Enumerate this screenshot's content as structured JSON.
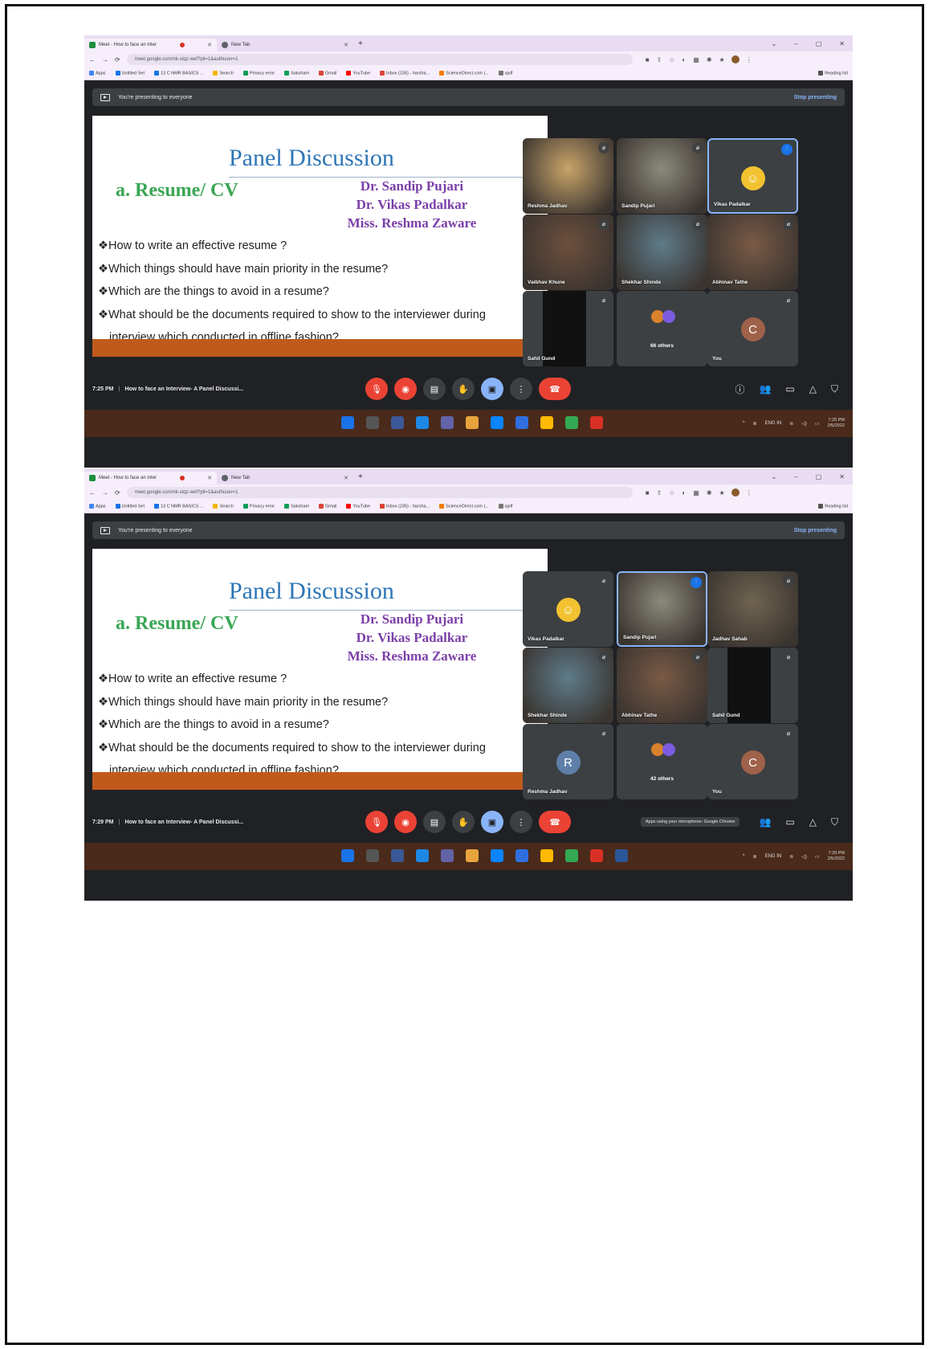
{
  "screens": [
    {
      "tabs": {
        "active": "Meet - How to face an inter",
        "inactive": "New Tab"
      },
      "url": "meet.google.com/nk-stqz-wef?pli=1&authuser=1",
      "bookmarks": [
        "Apps",
        "Untitled Set",
        "13 C NMR BASICS ...",
        "Search",
        "Privacy error",
        "Saksham",
        "Gmail",
        "YouTube",
        "Inbox (235) - harsha...",
        "ScienceDirect.com |...",
        "ajxlf"
      ],
      "reading_list": "Reading list",
      "presenting": {
        "text": "You're presenting to everyone",
        "stop": "Stop presenting"
      },
      "slide": {
        "title": "Panel Discussion",
        "subtitle": "a. Resume/ CV",
        "names": [
          "Dr. Sandip Pujari",
          "Dr. Vikas Padalkar",
          "Miss. Reshma Zaware"
        ],
        "bullets": [
          "❖How to write an effective resume ?",
          "❖Which things should have main priority in the resume?",
          "❖Which are the things to avoid in a resume?",
          "❖What should be the documents required to show to the interviewer during"
        ],
        "continuation": "interview which conducted in offline fashion?"
      },
      "tiles": [
        {
          "name": "Reshma Jadhav",
          "kind": "video",
          "color": "#c9a46a"
        },
        {
          "name": "Sandip Pujari",
          "kind": "video",
          "color": "#8c8a7c"
        },
        {
          "name": "Vikas Padalkar",
          "kind": "avatar",
          "color": "#f2c230",
          "speaking": true
        },
        {
          "name": "Vaibhav Khune",
          "kind": "video",
          "color": "#6d4f3c"
        },
        {
          "name": "Shekhar Shinde",
          "kind": "video",
          "color": "#5e7c8a"
        },
        {
          "name": "Abhinav Tathe",
          "kind": "video",
          "color": "#7a5a45"
        },
        {
          "name": "Sahil Gund",
          "kind": "video-dark",
          "color": "#111111"
        },
        {
          "name": "",
          "kind": "others",
          "others": "66 others"
        },
        {
          "name": "You",
          "kind": "letter",
          "letter": "C",
          "color": "#a0614a"
        }
      ],
      "time": "7:25 PM",
      "meeting": "How to face an Interview- A Panel Discussi...",
      "clock": {
        "time": "7:25 PM",
        "date": "2/5/2022"
      },
      "lang": "ENG IN",
      "toast": ""
    },
    {
      "tabs": {
        "active": "Meet - How to face an inter",
        "inactive": "New Tab"
      },
      "url": "meet.google.com/nk-stqz-wef?pli=1&authuser=1",
      "bookmarks": [
        "Apps",
        "Untitled Set",
        "13 C NMR BASICS ...",
        "Search",
        "Privacy error",
        "Saksham",
        "Gmail",
        "YouTube",
        "Inbox (235) - harsha...",
        "ScienceDirect.com |...",
        "ajxlf"
      ],
      "reading_list": "Reading list",
      "presenting": {
        "text": "You're presenting to everyone",
        "stop": "Stop presenting"
      },
      "slide": {
        "title": "Panel Discussion",
        "subtitle": "a. Resume/ CV",
        "names": [
          "Dr. Sandip Pujari",
          "Dr. Vikas Padalkar",
          "Miss. Reshma Zaware"
        ],
        "bullets": [
          "❖How to write an effective resume ?",
          "❖Which things should have main priority in the resume?",
          "❖Which are the things to avoid in a resume?",
          "❖What should be the documents required to show to the interviewer during"
        ],
        "continuation": "interview which conducted in offline fashion?"
      },
      "tiles": [
        {
          "name": "Vikas Padalkar",
          "kind": "avatar",
          "color": "#f2c230"
        },
        {
          "name": "Sandip Pujari",
          "kind": "video",
          "color": "#8c8a7c",
          "speaking": true
        },
        {
          "name": "Jadhav Sahab",
          "kind": "video",
          "color": "#6f6450"
        },
        {
          "name": "Shekhar Shinde",
          "kind": "video",
          "color": "#5e7c8a"
        },
        {
          "name": "Abhinav Tathe",
          "kind": "video",
          "color": "#7a5a45"
        },
        {
          "name": "Sahil Gund",
          "kind": "video-dark",
          "color": "#111111"
        },
        {
          "name": "Reshma Jadhav",
          "kind": "letter",
          "letter": "R",
          "color": "#5f7fa8"
        },
        {
          "name": "",
          "kind": "others",
          "others": "42 others"
        },
        {
          "name": "You",
          "kind": "letter",
          "letter": "C",
          "color": "#a0614a"
        }
      ],
      "time": "7:29 PM",
      "meeting": "How to face an Interview- A Panel Discussi...",
      "clock": {
        "time": "7:29 PM",
        "date": "2/5/2022"
      },
      "lang": "ENG IN",
      "toast": "Apps using your microphone: Google Chrome"
    }
  ],
  "icons": {
    "mic": "mic-off-icon",
    "cam": "camera-off-icon",
    "cc": "captions-icon",
    "hand": "raise-hand-icon",
    "present": "present-icon",
    "more": "more-options-icon",
    "end": "end-call-icon",
    "info": "info-icon",
    "people": "people-icon",
    "chat": "chat-icon",
    "activities": "activities-icon",
    "lock": "host-controls-icon"
  }
}
